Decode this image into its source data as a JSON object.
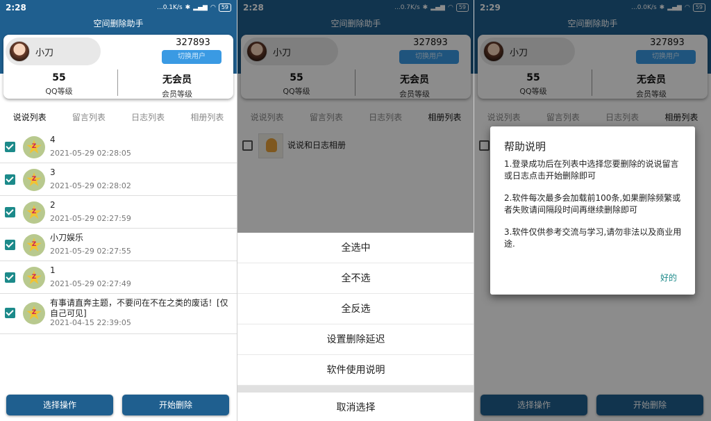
{
  "app_title": "空间删除助手",
  "panels": [
    {
      "time": "2:28",
      "speed": "...0.1K/s"
    },
    {
      "time": "2:28",
      "speed": "...0.7K/s"
    },
    {
      "time": "2:29",
      "speed": "...0.0K/s"
    }
  ],
  "battery": "59",
  "user": {
    "name": "小刀",
    "qq": "327893",
    "switch_label": "切换用户"
  },
  "stats": {
    "qq_level_value": "55",
    "qq_level_label": "QQ等级",
    "member_value": "无会员",
    "member_label": "会员等级"
  },
  "tabs": [
    "说说列表",
    "留言列表",
    "日志列表",
    "相册列表"
  ],
  "posts": [
    {
      "title": "4",
      "date": "2021-05-29 02:28:05"
    },
    {
      "title": "3",
      "date": "2021-05-29 02:28:02"
    },
    {
      "title": "2",
      "date": "2021-05-29 02:27:59"
    },
    {
      "title": "小刀娱乐",
      "date": "2021-05-29 02:27:55"
    },
    {
      "title": "1",
      "date": "2021-05-29 02:27:49"
    },
    {
      "title": "有事请直奔主题，不要问在不在之类的废话！[仅自己可见]",
      "date": "2021-04-15 22:39:05"
    }
  ],
  "album": {
    "title": "说说和日志相册"
  },
  "buttons": {
    "select": "选择操作",
    "start": "开始删除"
  },
  "sheet": {
    "items": [
      "全选中",
      "全不选",
      "全反选",
      "设置删除延迟",
      "软件使用说明"
    ],
    "cancel": "取消选择"
  },
  "dialog": {
    "title": "帮助说明",
    "lines": [
      "1.登录成功后在列表中选择您要删除的说说留言或日志点击开始删除即可",
      "2.软件每次最多会加载前100条,如果删除频繁或者失败请间隔段时间再继续删除即可",
      "3.软件仅供参考交流与学习,请勿非法以及商业用途."
    ],
    "ok": "好的"
  },
  "colors": {
    "primary": "#1f5f8f",
    "accent": "#1c8a8a",
    "switch_button": "#3a9ae3"
  }
}
